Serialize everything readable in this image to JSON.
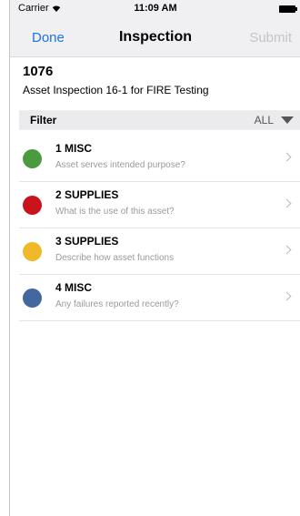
{
  "status_bar": {
    "carrier": "Carrier",
    "time": "11:09 AM"
  },
  "nav": {
    "done_label": "Done",
    "title": "Inspection",
    "submit_label": "Submit"
  },
  "asset": {
    "id": "1076",
    "name": "Asset Inspection 16-1 for FIRE Testing"
  },
  "filter": {
    "label": "Filter",
    "value": "ALL"
  },
  "items": [
    {
      "name": "1 MISC",
      "description": "Asset serves intended purpose?",
      "color": "#4c9a3f"
    },
    {
      "name": "2 SUPPLIES",
      "description": "What is the use of this asset?",
      "color": "#c8141a"
    },
    {
      "name": "3 SUPPLIES",
      "description": "Describe how asset functions",
      "color": "#f0b92a"
    },
    {
      "name": "4 MISC",
      "description": "Any failures reported recently?",
      "color": "#44679f"
    }
  ]
}
